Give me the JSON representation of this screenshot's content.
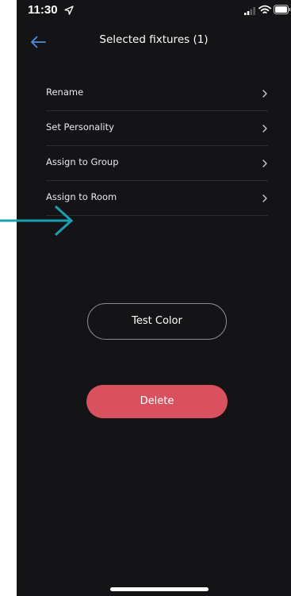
{
  "status_bar": {
    "time": "11:30"
  },
  "header": {
    "title": "Selected fixtures (1)"
  },
  "menu": {
    "items": [
      {
        "label": "Rename"
      },
      {
        "label": "Set Personality"
      },
      {
        "label": "Assign to Group"
      },
      {
        "label": "Assign to Room"
      }
    ]
  },
  "actions": {
    "test_color_label": "Test Color",
    "delete_label": "Delete"
  },
  "colors": {
    "background": "#141417",
    "accent_back": "#4a8fe0",
    "delete": "#d9505e",
    "annotation_arrow": "#1aa0b0"
  },
  "icons": {
    "back": "arrow-left-icon",
    "chevron": "chevron-right-icon",
    "location": "location-arrow-icon",
    "signal": "signal-icon",
    "wifi": "wifi-icon",
    "battery": "battery-icon"
  }
}
